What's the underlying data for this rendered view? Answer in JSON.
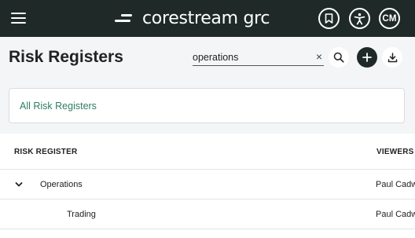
{
  "header": {
    "logo_text": "corestream grc",
    "avatar_initials": "CM",
    "icons": [
      "menu-icon",
      "logo-mark-icon",
      "bookmark-icon",
      "accessibility-icon"
    ]
  },
  "page": {
    "title": "Risk Registers"
  },
  "search": {
    "value": "operations",
    "clear_label": "×"
  },
  "toolbar": {
    "icons": [
      "search-icon",
      "add-icon",
      "download-icon"
    ]
  },
  "filter": {
    "label": "All Risk Registers"
  },
  "table": {
    "columns": [
      "RISK REGISTER",
      "VIEWERS"
    ],
    "rows": [
      {
        "name": "Operations",
        "viewers": "Paul Cadw",
        "expanded": true,
        "level": 0
      },
      {
        "name": "Trading",
        "viewers": "Paul Cadw",
        "level": 1
      }
    ]
  },
  "colors": {
    "header_bg": "#1f2a28",
    "page_bg": "#f4f5f6",
    "link": "#2e7d5f"
  }
}
